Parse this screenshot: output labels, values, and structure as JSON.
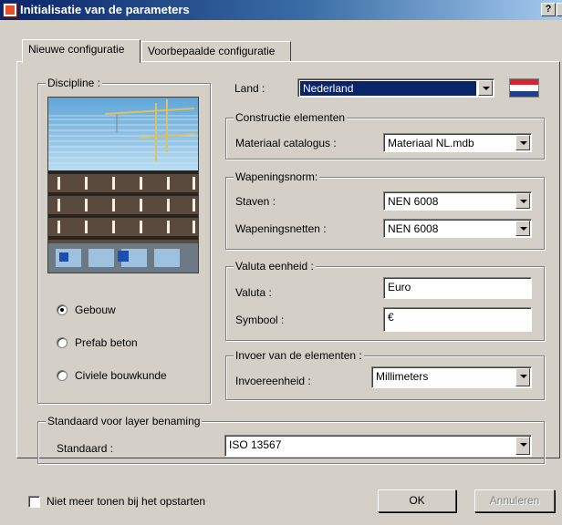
{
  "window": {
    "title": "Initialisatie van de parameters",
    "help_label": "?"
  },
  "tabs": [
    {
      "label": "Nieuwe configuratie",
      "active": true
    },
    {
      "label": "Voorbepaalde configuratie",
      "active": false
    }
  ],
  "discipline": {
    "legend": "Discipline :",
    "image": "building-construction-photo",
    "options": [
      {
        "label": "Gebouw",
        "checked": true
      },
      {
        "label": "Prefab beton",
        "checked": false
      },
      {
        "label": "Civiele bouwkunde",
        "checked": false
      }
    ]
  },
  "land": {
    "label": "Land :",
    "value": "Nederland",
    "flag_colors": [
      "#d8232b",
      "#ffffff",
      "#1d3f8e"
    ]
  },
  "constructie": {
    "legend": "Constructie elementen",
    "catalogus_label": "Materiaal catalogus :",
    "catalogus_value": "Materiaal NL.mdb"
  },
  "wapening": {
    "legend": "Wapeningsnorm:",
    "staven_label": "Staven :",
    "staven_value": "NEN 6008",
    "netten_label": "Wapeningsnetten :",
    "netten_value": "NEN 6008"
  },
  "valuta": {
    "legend": "Valuta eenheid :",
    "valuta_label": "Valuta :",
    "valuta_value": "Euro",
    "symbool_label": "Symbool :",
    "symbool_value": "€"
  },
  "invoer": {
    "legend": "Invoer van de elementen :",
    "eenheid_label": "Invoereenheid :",
    "eenheid_value": "Millimeters"
  },
  "layer": {
    "legend": "Standaard voor layer benaming",
    "standaard_label": "Standaard :",
    "standaard_value": "ISO 13567"
  },
  "footer": {
    "checkbox_label": "Niet meer tonen bij het opstarten",
    "ok_label": "OK",
    "cancel_label": "Annuleren"
  }
}
